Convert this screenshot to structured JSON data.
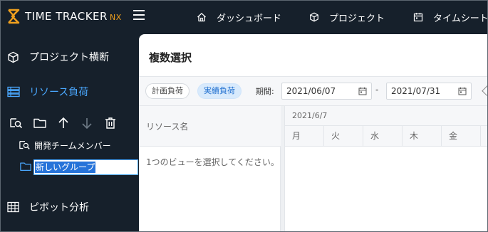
{
  "app": {
    "brand_text": "TIME TRACKER",
    "brand_suffix": "NX"
  },
  "topnav": {
    "items": [
      {
        "label": "ダッシュボード",
        "icon": "home-icon"
      },
      {
        "label": "プロジェクト",
        "icon": "cube-icon"
      },
      {
        "label": "タイムシート",
        "icon": "calendar-icon"
      }
    ]
  },
  "sidebar": {
    "items": [
      {
        "label": "プロジェクト横断",
        "icon": "cube-icon",
        "active": false
      },
      {
        "label": "リソース負荷",
        "icon": "resource-list-icon",
        "active": true
      },
      {
        "label": "ピボット分析",
        "icon": "table-grid-icon",
        "active": false
      }
    ],
    "tree": {
      "views": [
        {
          "label": "開発チームメンバー",
          "icon": "view-search-icon"
        }
      ],
      "editing_value": "新しいグループ"
    }
  },
  "main": {
    "title": "複数選択",
    "toolbar": {
      "chip_plan": "計画負荷",
      "chip_actual": "実績負荷",
      "period_label": "期間:",
      "date_from": "2021/06/07",
      "date_separator": "-",
      "date_to": "2021/07/31"
    },
    "resource_header": "リソース名",
    "empty_message": "1つのビューを選択してください。",
    "calendar": {
      "week_label": "2021/6/7",
      "days": [
        "月",
        "火",
        "水",
        "木",
        "金"
      ]
    }
  },
  "colors": {
    "background": "#16202b",
    "accent": "#4aa8ff",
    "brand_orange": "#f0a01e",
    "selection": "#2673d9"
  }
}
